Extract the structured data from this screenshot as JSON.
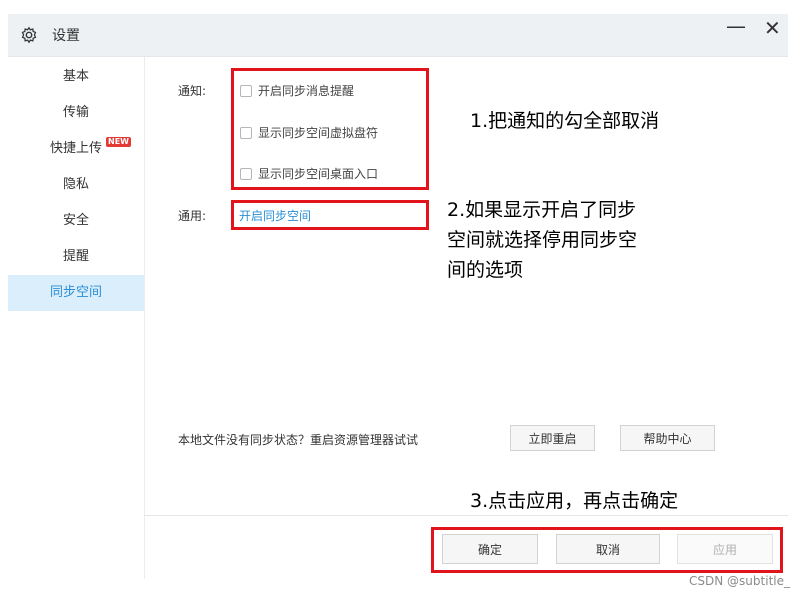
{
  "window": {
    "title": "设置",
    "minimize_symbol": "—",
    "close_symbol": "✕"
  },
  "sidebar": {
    "items": [
      {
        "label": "基本"
      },
      {
        "label": "传输"
      },
      {
        "label": "快捷上传",
        "badge": "NEW"
      },
      {
        "label": "隐私"
      },
      {
        "label": "安全"
      },
      {
        "label": "提醒"
      },
      {
        "label": "同步空间",
        "active": true
      }
    ]
  },
  "notify": {
    "label": "通知:",
    "options": [
      {
        "label": "开启同步消息提醒",
        "checked": false
      },
      {
        "label": "显示同步空间虚拟盘符",
        "checked": false
      },
      {
        "label": "显示同步空间桌面入口",
        "checked": false
      }
    ]
  },
  "general": {
    "label": "通用:",
    "link": "开启同步空间"
  },
  "restart": {
    "hint": "本地文件没有同步状态？重启资源管理器试试",
    "restart_button": "立即重启",
    "help_button": "帮助中心"
  },
  "footer": {
    "ok": "确定",
    "cancel": "取消",
    "apply": "应用"
  },
  "annotations": {
    "step1": "1.把通知的勾全部取消",
    "step2_line1": "2.如果显示开启了同步",
    "step2_line2": "空间就选择停用同步空",
    "step2_line3": "间的选项",
    "step3": "3.点击应用，再点击确定"
  },
  "colors": {
    "annotation_red": "#e0141a",
    "accent_blue": "#2b8fd6",
    "active_bg": "#dbeefc",
    "badge_red": "#e53935"
  },
  "watermark": "CSDN @subtitle_"
}
